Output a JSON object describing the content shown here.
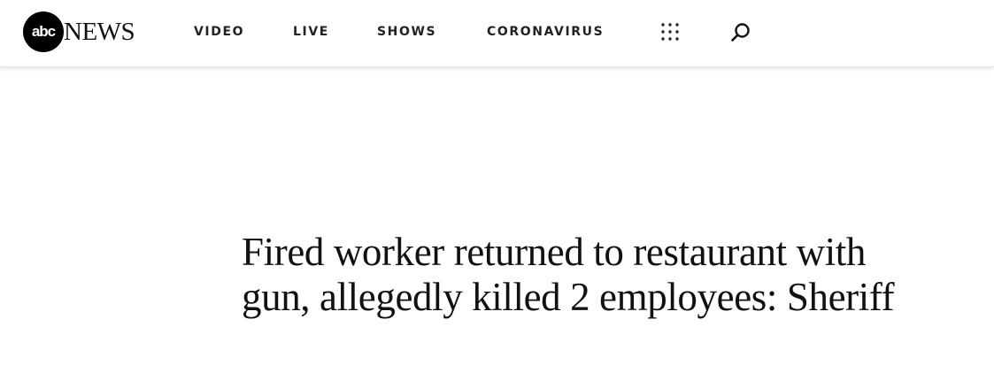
{
  "brand": {
    "logo_mark": "abc",
    "logo_word": "NEWS"
  },
  "nav": {
    "items": [
      {
        "label": "VIDEO"
      },
      {
        "label": "LIVE"
      },
      {
        "label": "SHOWS"
      },
      {
        "label": "CORONAVIRUS"
      }
    ],
    "menu_icon": "grid-dots-icon",
    "search_icon": "search-icon"
  },
  "article": {
    "headline": "Fired worker returned to restaurant with gun, allegedly killed 2 employees: Sheriff"
  },
  "colors": {
    "text": "#111111",
    "background": "#ffffff",
    "logo_disc": "#000000"
  }
}
